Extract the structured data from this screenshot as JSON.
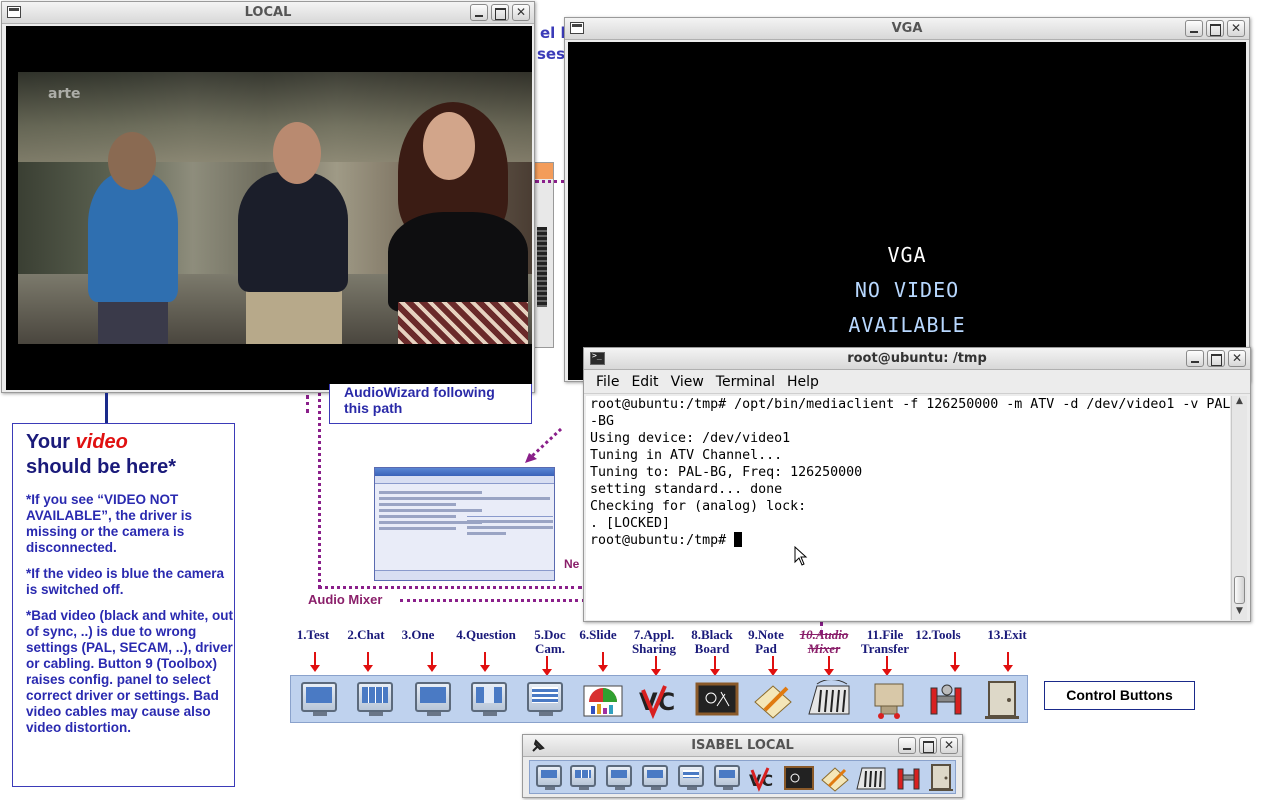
{
  "local_window": {
    "title": "LOCAL",
    "video_watermark": "arte"
  },
  "vga_window": {
    "title": "VGA",
    "line1": "VGA",
    "line2": "NO VIDEO",
    "line3": "AVAILABLE"
  },
  "terminal": {
    "title": "root@ubuntu: /tmp",
    "menu": [
      "File",
      "Edit",
      "View",
      "Terminal",
      "Help"
    ],
    "lines": [
      "root@ubuntu:/tmp# /opt/bin/mediaclient -f 126250000 -m ATV -d /dev/video1 -v PAL",
      "-BG",
      "Using device: /dev/video1",
      "Tuning in ATV Channel...",
      "Tuning to: PAL-BG, Freq: 126250000",
      "setting standard... done",
      "Checking for (analog) lock:",
      ". [LOCKED]",
      "root@ubuntu:/tmp# "
    ]
  },
  "annotations": {
    "frag1": "el h",
    "frag2": "ses",
    "wizard_line1": "AudioWizard following",
    "wizard_line2": "this path",
    "audio_mixer": "Audio Mixer",
    "ne_label": "Ne",
    "control_buttons": "Control Buttons"
  },
  "info_box": {
    "heading_pre": "Your ",
    "heading_em": "video",
    "heading_post": "should be here*",
    "p1": "*If you see “VIDEO NOT AVAILABLE”, the driver is missing or the camera is disconnected.",
    "p2": "*If the video is blue the camera is switched off.",
    "p3": "*Bad video (black and white, out of sync, ..) is due to wrong settings (PAL, SECAM, ..), driver or cabling. Button 9 (Toolbox) raises config. panel to select correct driver or settings. Bad video cables may cause also video distortion."
  },
  "control_bar": {
    "labels": [
      [
        "1.Test",
        ""
      ],
      [
        "2.Chat",
        ""
      ],
      [
        "3.One",
        ""
      ],
      [
        "4.Question",
        ""
      ],
      [
        "5.Doc",
        "Cam."
      ],
      [
        "6.Slide",
        ""
      ],
      [
        "7.Appl.",
        "Sharing"
      ],
      [
        "8.Black",
        "Board"
      ],
      [
        "9.Note",
        "Pad"
      ],
      [
        "10.Audio",
        "Mixer"
      ],
      [
        "11.File",
        "Transfer"
      ],
      [
        "12.Tools",
        ""
      ],
      [
        "13.Exit",
        ""
      ]
    ],
    "buttons": [
      "test-icon",
      "chat-icon",
      "one-icon",
      "question-icon",
      "doc-cam-icon",
      "slide-icon",
      "app-sharing-icon",
      "blackboard-icon",
      "notepad-icon",
      "audio-mixer-icon",
      "file-transfer-icon",
      "tools-icon",
      "exit-icon"
    ]
  },
  "isabel_window": {
    "title": "ISABEL LOCAL"
  },
  "colors": {
    "accent_blue": "#1a1a7a",
    "annotation_purple": "#8a1f8a",
    "arrow_red": "#e01010",
    "toolbar_bg": "#bfd2ee"
  }
}
